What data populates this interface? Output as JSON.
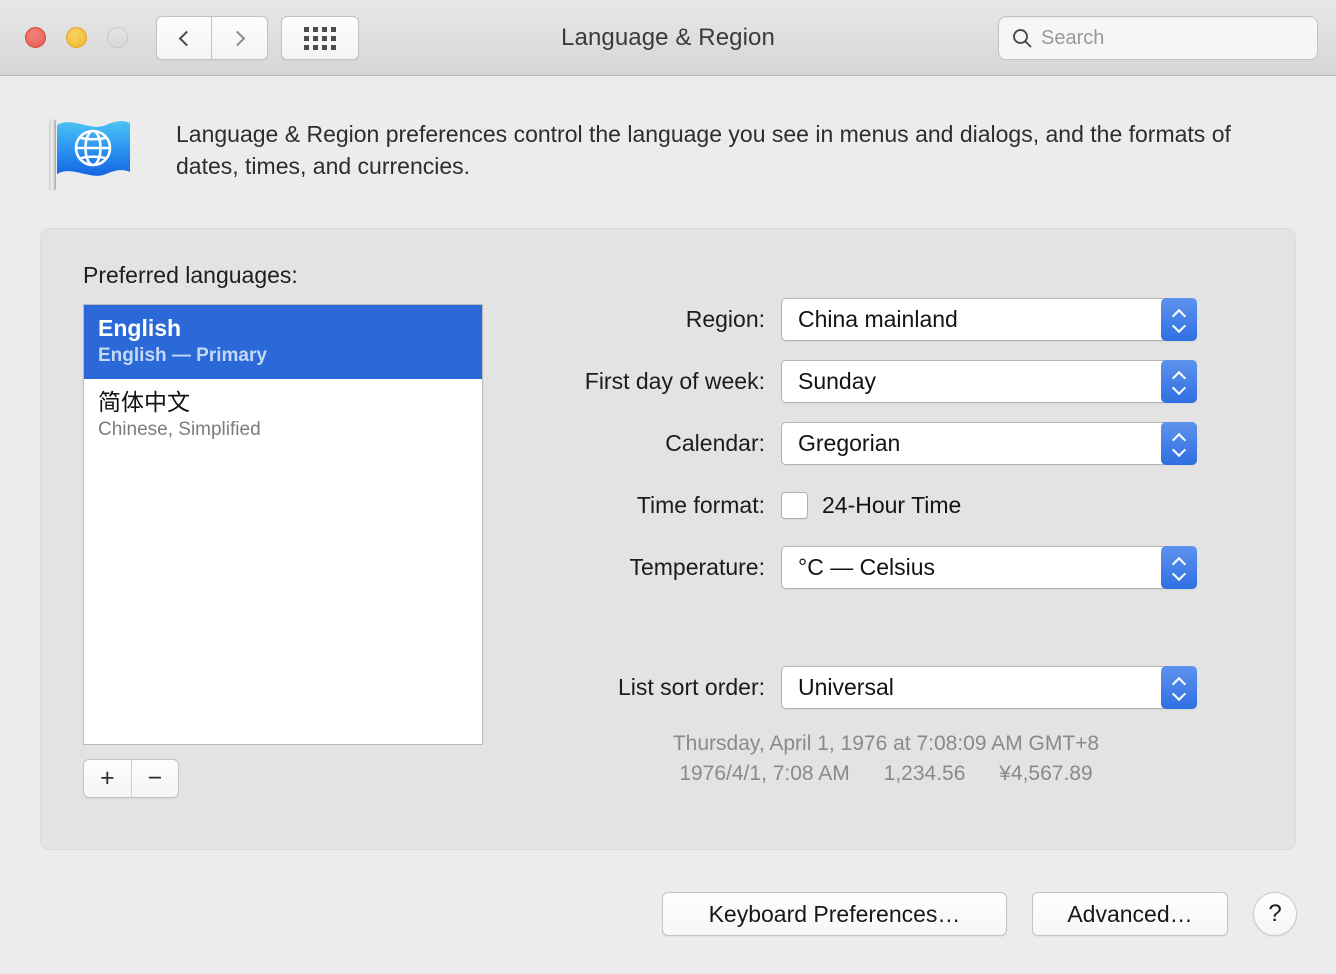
{
  "titlebar": {
    "title": "Language & Region",
    "back_icon": "chevron-left-icon",
    "forward_icon": "chevron-right-icon",
    "grid_icon": "grid-view-icon",
    "close_label": "Close",
    "minimize_label": "Minimize",
    "zoom_label": "Zoom",
    "search": {
      "placeholder": "Search",
      "value": "",
      "icon": "search-icon"
    }
  },
  "banner": {
    "icon": "flag-globe-icon",
    "description": "Language & Region preferences control the language you see in menus and dialogs, and the formats of dates, times, and currencies."
  },
  "panel": {
    "preferred_languages_label": "Preferred languages:",
    "languages": [
      {
        "name": "English",
        "subtitle": "English — Primary",
        "selected": true
      },
      {
        "name": "简体中文",
        "subtitle": "Chinese, Simplified",
        "selected": false
      }
    ],
    "add_button": "+",
    "remove_button": "−",
    "fields": [
      {
        "label": "Region:",
        "value": "China mainland",
        "type": "popup"
      },
      {
        "label": "First day of week:",
        "value": "Sunday",
        "type": "popup"
      },
      {
        "label": "Calendar:",
        "value": "Gregorian",
        "type": "popup"
      },
      {
        "label": "Time format:",
        "value": "24-Hour Time",
        "type": "checkbox",
        "checked": false
      },
      {
        "label": "Temperature:",
        "value": "°C — Celsius",
        "type": "popup"
      },
      {
        "label": "List sort order:",
        "value": "Universal",
        "type": "popup"
      }
    ],
    "sample": {
      "line1": "Thursday, April 1, 1976 at 7:08:09 AM GMT+8",
      "date_short": "1976/4/1, 7:08 AM",
      "number": "1,234.56",
      "currency": "¥4,567.89"
    }
  },
  "footer": {
    "keyboard_preferences": "Keyboard Preferences…",
    "advanced": "Advanced…",
    "help": "?"
  },
  "colors": {
    "selection_blue": "#2a69d7",
    "stepper_blue": "#2f6fe0",
    "window_bg": "#ececec",
    "panel_bg": "#e3e3e3"
  }
}
